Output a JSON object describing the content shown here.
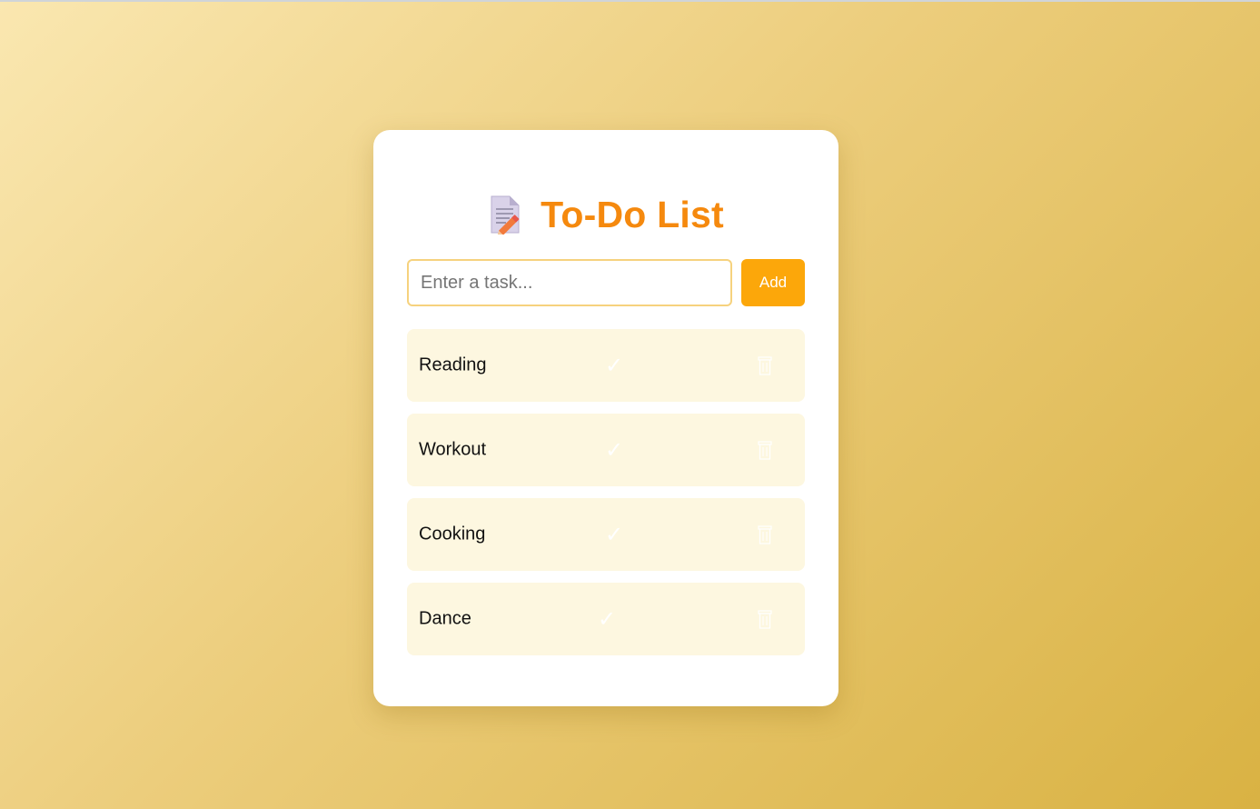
{
  "app": {
    "title": "To-Do List",
    "title_icon": "memo-pencil-icon"
  },
  "input": {
    "placeholder": "Enter a task...",
    "value": ""
  },
  "add_button": {
    "label": "Add"
  },
  "tasks": [
    {
      "label": "Reading",
      "check_icon": "✓",
      "delete_icon": "trash-icon"
    },
    {
      "label": "Workout",
      "check_icon": "✓",
      "delete_icon": "trash-icon"
    },
    {
      "label": "Cooking",
      "check_icon": "✓",
      "delete_icon": "trash-icon"
    },
    {
      "label": "Dance",
      "check_icon": "✓",
      "delete_icon": "trash-icon"
    }
  ],
  "colors": {
    "accent": "#f5890e",
    "button": "#fca70a",
    "item_background": "#fdf7e0",
    "input_border": "#f6d27e"
  }
}
